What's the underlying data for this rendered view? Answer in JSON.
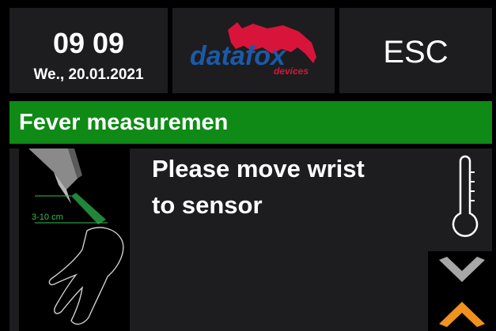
{
  "header": {
    "time": "09 09",
    "date": "We., 20.01.2021",
    "logo_text": "datafox",
    "logo_subtext": "devices",
    "esc_label": "ESC"
  },
  "title": "Fever measuremen",
  "message": {
    "line1": "Please move wrist",
    "line2": "to sensor"
  },
  "illustration": {
    "distance_label": "3-10 cm"
  },
  "icons": {
    "thermometer": "thermometer-icon",
    "scroll_down": "chevron-down-icon",
    "scroll_up": "chevron-up-icon"
  },
  "colors": {
    "title_bar": "#0f8a16",
    "tile_background": "#1d1d1f",
    "logo_blue": "#1b5aa8",
    "logo_red": "#d9143a",
    "chevron_down": "#a7a7a7",
    "chevron_up": "#f0921e",
    "distance_green": "#2fbf4f"
  }
}
